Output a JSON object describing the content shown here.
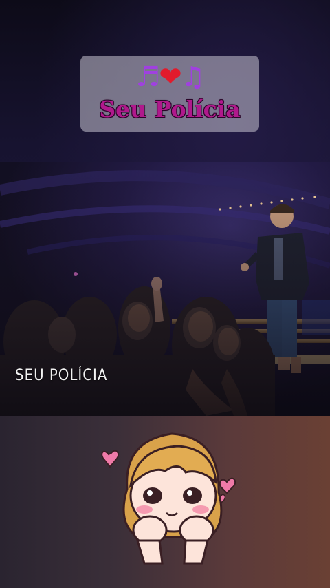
{
  "sticker": {
    "emoji_line": "🎵❤️🎶",
    "title": "Seu Polícia"
  },
  "video": {
    "caption": "SEU POLÍCIA"
  },
  "colors": {
    "sticker_text": "#b0198c",
    "sticker_bg": "#c8c4d2"
  },
  "icons": [
    "music-note-icon",
    "heart-icon",
    "music-notes-icon",
    "cartoon-girl-sticker",
    "pink-heart-icon"
  ]
}
